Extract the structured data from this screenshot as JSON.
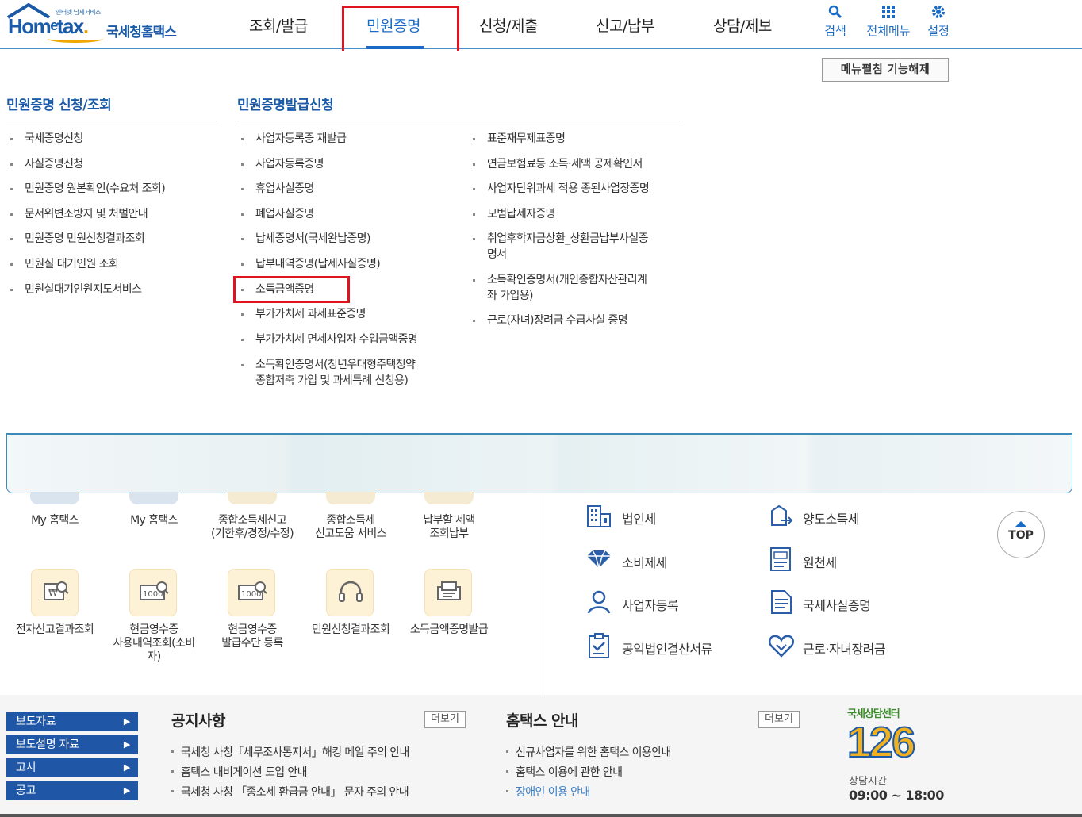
{
  "header": {
    "logo_small": "인터넷 납세서비스",
    "logo_main_a": "Hom",
    "logo_main_b": "e",
    "logo_main_c": "tax",
    "logo_main_dot": ".",
    "logo_sub": "국세청홈택스",
    "nav": [
      "조회/발급",
      "민원증명",
      "신청/제출",
      "신고/납부",
      "상담/제보"
    ],
    "active_nav": "민원증명",
    "utils": [
      {
        "icon": "search-icon",
        "label": "검색"
      },
      {
        "icon": "grid-menu-icon",
        "label": "전체메뉴"
      },
      {
        "icon": "gear-icon",
        "label": "설정"
      }
    ],
    "highlight_color": "#e0141e",
    "accent_color": "#1a6bc6"
  },
  "mega_menu": {
    "fold_button": "메뉴펼침 기능해제",
    "col1_title": "민원증명 신청/조회",
    "col1": [
      "국세증명신청",
      "사실증명신청",
      "민원증명 원본확인(수요처 조회)",
      "문서위변조방지 및 처벌안내",
      "민원증명 민원신청결과조회",
      "민원실 대기인원 조회",
      "민원실대기인원지도서비스"
    ],
    "col2_title": "민원증명발급신청",
    "col2": [
      "사업자등록증 재발급",
      "사업자등록증명",
      "휴업사실증명",
      "폐업사실증명",
      "납세증명서(국세완납증명)",
      "납부내역증명(납세사실증명)",
      "소득금액증명",
      "부가가치세 과세표준증명",
      "부가가치세 면세사업자 수입금액증명",
      "소득확인증명서(청년우대형주택청약",
      "종합저축 가입 및 과세특례 신청용)"
    ],
    "col3": [
      "표준재무제표증명",
      "연금보험료등 소득·세액 공제확인서",
      "사업자단위과세 적용 종된사업장증명",
      "모범납세자증명",
      "취업후학자금상환_상환금납부사실증",
      "명서",
      "소득확인증명서(개인종합자산관리계",
      "좌 가입용)",
      "근로(자녀)장려금 수급사실 증명"
    ]
  },
  "quick": {
    "row1": [
      "My 홈택스",
      "My 홈택스",
      "종합소득세신고",
      "(기한후/경정/수정)",
      "종합소득세",
      "신고도움 서비스",
      "납부할 세액",
      "조회납부"
    ],
    "row2": [
      "전자신고결과조회",
      "현금영수증",
      "사용내역조회(소비",
      "자)",
      "현금영수증",
      "발급수단 등록",
      "민원신청결과조회",
      "소득금액증명발급"
    ]
  },
  "tax_menu": [
    {
      "icon": "corporate-building-icon",
      "label": "법인세"
    },
    {
      "icon": "transfer-document-icon",
      "label": "양도소득세"
    },
    {
      "icon": "diamond-icon",
      "label": "소비제세"
    },
    {
      "icon": "withholding-document-icon",
      "label": "원천세"
    },
    {
      "icon": "person-icon",
      "label": "사업자등록"
    },
    {
      "icon": "certificate-document-icon",
      "label": "국세사실증명"
    },
    {
      "icon": "clipboard-check-icon",
      "label": "공익법인결산서류"
    },
    {
      "icon": "heart-hands-icon",
      "label": "근로·자녀장려금"
    }
  ],
  "top_button": "TOP",
  "footer": {
    "side_buttons": [
      "보도자료",
      "보도설명 자료",
      "고시",
      "공고"
    ],
    "notice_title": "공지사항",
    "notice_more": "더보기",
    "notices": [
      "국세청 사칭「세무조사통지서」해킹 메일 주의 안내",
      "홈택스 내비게이션 도입 안내",
      "국세청 사칭 「종소세 환급금 안내」 문자 주의 안내"
    ],
    "guide_title": "홈택스 안내",
    "guide_more": "더보기",
    "guides": [
      "신규사업자를 위한 홈택스 이용안내",
      "홈택스 이용에 관한 안내",
      "장애인 이용 안내"
    ],
    "center_label": "국세상담센터",
    "center_number": "126",
    "hours_label": "상담시간",
    "hours": "09:00 ~ 18:00"
  }
}
